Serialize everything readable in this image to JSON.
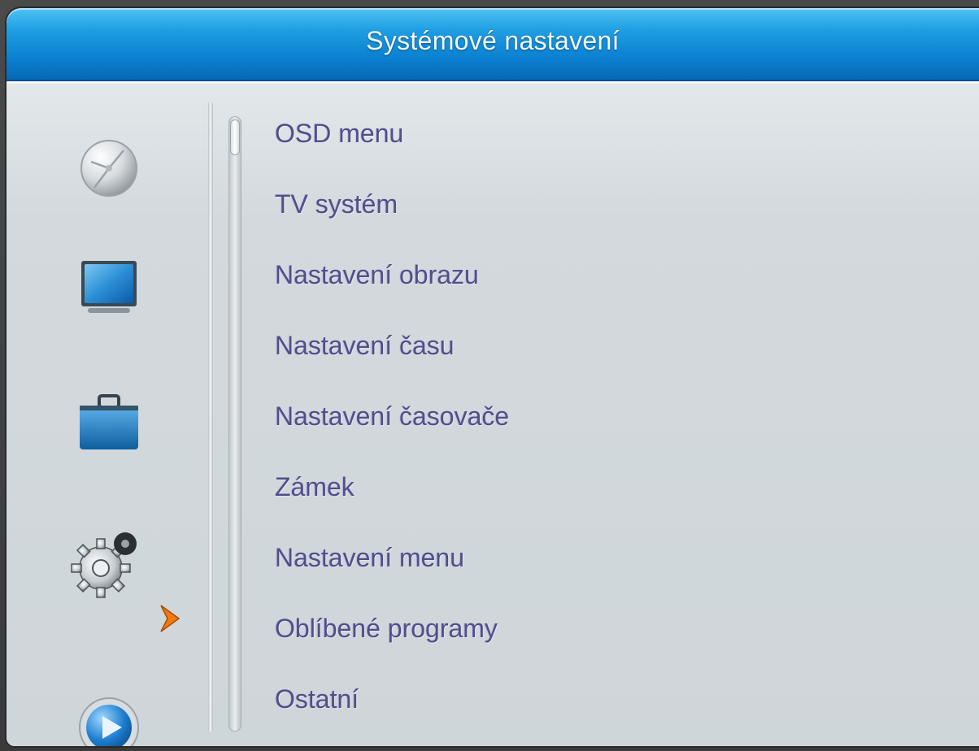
{
  "header": {
    "title": "Systémové nastavení"
  },
  "sidebar": {
    "icons": [
      {
        "name": "satellite-dish-icon"
      },
      {
        "name": "tv-monitor-icon"
      },
      {
        "name": "toolbox-icon"
      },
      {
        "name": "settings-gear-icon",
        "selected": true
      },
      {
        "name": "media-play-icon"
      }
    ],
    "selection_indicator": "chevron-right-icon"
  },
  "menu": {
    "items": [
      {
        "label": "OSD menu"
      },
      {
        "label": "TV systém"
      },
      {
        "label": "Nastavení obrazu"
      },
      {
        "label": "Nastavení času"
      },
      {
        "label": "Nastavení časovače"
      },
      {
        "label": "Zámek"
      },
      {
        "label": "Nastavení menu"
      },
      {
        "label": "Oblíbené programy"
      },
      {
        "label": "Ostatní"
      }
    ]
  },
  "colors": {
    "title_bar": "#0a7fcf",
    "panel": "#cfd6da",
    "menu_text": "#4f4f8c",
    "accent_chevron": "#f07a10"
  }
}
